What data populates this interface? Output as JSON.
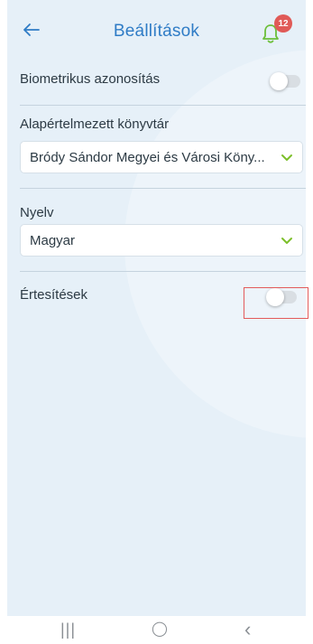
{
  "header": {
    "title": "Beállítások",
    "back_icon": "arrow-left-icon",
    "notifications_icon": "bell-icon",
    "notification_count": "12"
  },
  "settings": {
    "biometric": {
      "label": "Biometrikus azonosítás",
      "enabled": false
    },
    "default_library": {
      "label": "Alapértelmezett könyvtár",
      "value": "Bródy Sándor Megyei és Városi Köny..."
    },
    "language": {
      "label": "Nyelv",
      "value": "Magyar"
    },
    "notifications": {
      "label": "Értesítések",
      "enabled": false
    }
  },
  "nav": {
    "recents": "|||",
    "home": "◯",
    "back": "‹"
  },
  "colors": {
    "accent": "#2f7cc6",
    "bell": "#6cbf3a",
    "chevron": "#7cbf2a",
    "badge": "#e05a57",
    "highlight": "#e35b5b",
    "background": "#e6f0f8"
  }
}
